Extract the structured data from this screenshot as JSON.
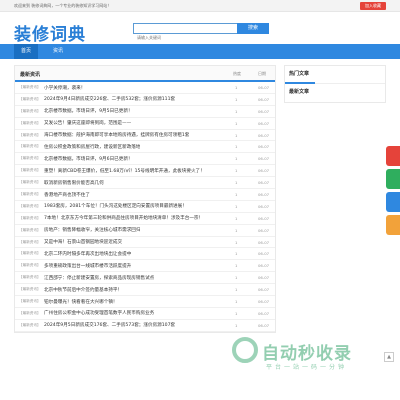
{
  "topbar": {
    "welcome": "欢迎来到 装修词典网，一个专业的装修知识学习网站！",
    "fav_button": "加入收藏"
  },
  "header": {
    "logo": "装修词典",
    "search_placeholder": "请输入关键词",
    "search_button": "搜索"
  },
  "nav": {
    "items": [
      "首页",
      "资讯"
    ],
    "active": 0
  },
  "main": {
    "title": "最新资讯",
    "col_hits": "热度",
    "col_date": "日期",
    "rows": [
      {
        "tag": "【最新资讯】",
        "title": "小学关停潮，袭来！",
        "hits": "1",
        "date": "06-07"
      },
      {
        "tag": "【最新资讯】",
        "title": "2024年9月4日新房成交226套、二手房532套；涨价房源111套",
        "hits": "1",
        "date": "06-07"
      },
      {
        "tag": "【最新资讯】",
        "title": "北京楼市数据，市场日评，9月5日已更新！",
        "hits": "1",
        "date": "06-07"
      },
      {
        "tag": "【最新资讯】",
        "title": "又发公告！肇庆这座即将到岗，范围是——",
        "hits": "1",
        "date": "06-07"
      },
      {
        "tag": "【最新资讯】",
        "title": "海口楼市数据：葭护海南即可享本地购房待遇，挂牌房有住房可领租1套",
        "hits": "1",
        "date": "06-07"
      },
      {
        "tag": "【最新资讯】",
        "title": "住房公积金政策和房屋行政，建设新区新政落地",
        "hits": "1",
        "date": "06-07"
      },
      {
        "tag": "【最新资讯】",
        "title": "北京楼市数据，市场日评，9月6日已更新！",
        "hits": "1",
        "date": "06-07"
      },
      {
        "tag": "【最新资讯】",
        "title": "重塑！离新CBD卷王爆价，低至1.68万/㎡！15号线明年开通，此板块要火了！",
        "hits": "1",
        "date": "06-07"
      },
      {
        "tag": "【最新资讯】",
        "title": "取消新房销售限价能否高几何",
        "hits": "1",
        "date": "06-07"
      },
      {
        "tag": "【最新资讯】",
        "title": "香港地产商也顶不住了",
        "hits": "1",
        "date": "06-07"
      },
      {
        "tag": "【最新资讯】",
        "title": "1983套房，2081个车位！门头沟这处楼区定向安置房项目最新进展！",
        "hits": "1",
        "date": "06-07"
      },
      {
        "tag": "【最新资讯】",
        "title": "7本地！北京东方今年第三轮和供商品住房项目开始地块清单！涉及丰台一宗！",
        "hits": "1",
        "date": "06-07"
      },
      {
        "tag": "【最新资讯】",
        "title": "房地产：销售降幅收窄，关注核心城市需求回归",
        "hits": "1",
        "date": "06-07"
      },
      {
        "tag": "【最新资讯】",
        "title": "又是中海！石景山首钢园地块迎近成交",
        "hits": "1",
        "date": "06-07"
      },
      {
        "tag": "【最新资讯】",
        "title": "北京二环内时隔多年再次出地块出让会提中",
        "hits": "1",
        "date": "06-07"
      },
      {
        "tag": "【最新资讯】",
        "title": "多项重磅政策出台一线城市楼市活跃度提升",
        "hits": "1",
        "date": "06-07"
      },
      {
        "tag": "【最新资讯】",
        "title": "江西邵宁：停止新建安置房，探索商品房现房销售试点",
        "hits": "1",
        "date": "06-07"
      },
      {
        "tag": "【最新资讯】",
        "title": "北京中秋节前后中介签约量基本持平！",
        "hits": "1",
        "date": "06-07"
      },
      {
        "tag": "【最新资讯】",
        "title": "铂尔曼曝光！快看看在大兴哪个镇！",
        "hits": "1",
        "date": "06-07"
      },
      {
        "tag": "【最新资讯】",
        "title": "广州住房公积金中心成功受理首笔数字人民币购房业务",
        "hits": "1",
        "date": "06-07"
      },
      {
        "tag": "【最新资讯】",
        "title": "2024年9月5日新房成交176套、二手房573套；涨价房源107套",
        "hits": "1",
        "date": "06-07"
      }
    ]
  },
  "side": {
    "hot_title": "热门文章",
    "new_title": "最新文章"
  },
  "watermark": {
    "text": "自动秒收录",
    "sub": "平台一站一码一分钟"
  },
  "colors": {
    "brand": "#2f88e0",
    "fav": "#e5433a"
  }
}
